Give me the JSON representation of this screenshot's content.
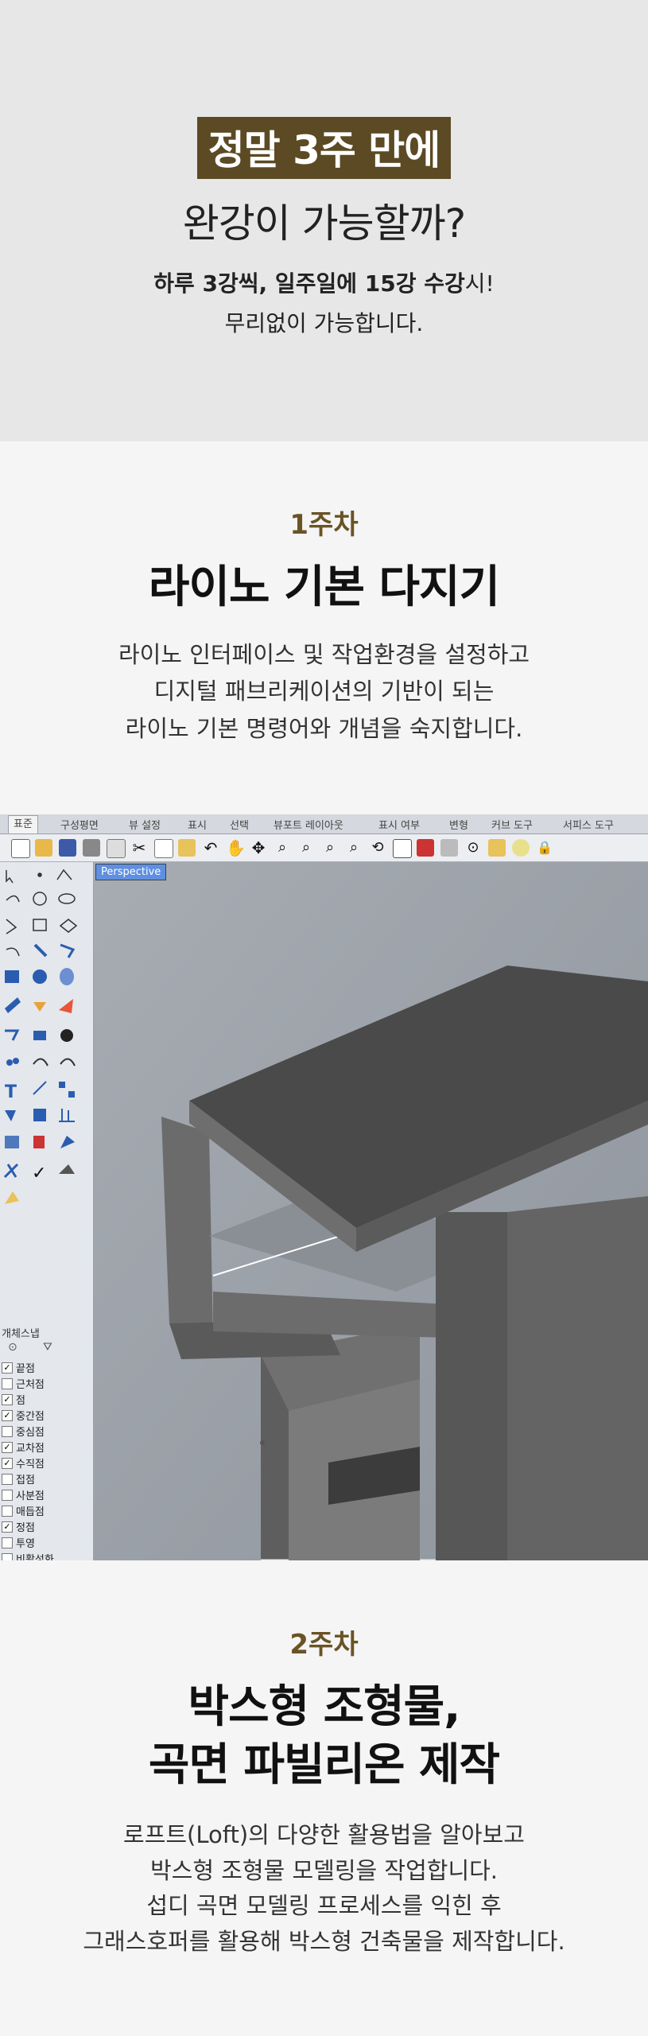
{
  "hero": {
    "title": "정말 3주 만에",
    "subtitle": "완강이 가능할까?",
    "line1_bold": "하루 3강씩, 일주일에 15강 수강",
    "line1_rest": "시!",
    "line2": "무리없이 가능합니다."
  },
  "week1": {
    "label": "1주차",
    "title": "라이노 기본 다지기",
    "desc": [
      "라이노 인터페이스 및 작업환경을 설정하고",
      "디지털 패브리케이션의 기반이 되는",
      "라이노 기본 명령어와 개념을 숙지합니다."
    ]
  },
  "rhino": {
    "tabs": [
      "표준",
      "구성평면",
      "뷰 설정",
      "표시",
      "선택",
      "뷰포트 레이아웃",
      "표시 여부",
      "변형",
      "커브 도구",
      "서피스 도구"
    ],
    "viewport_label": "Perspective",
    "osnap_title": "개체스냅",
    "osnaps": [
      {
        "label": "끝점",
        "checked": "✓"
      },
      {
        "label": "근처점",
        "checked": ""
      },
      {
        "label": "점",
        "checked": "✓"
      },
      {
        "label": "중간점",
        "checked": "✓"
      },
      {
        "label": "중심점",
        "checked": ""
      },
      {
        "label": "교차점",
        "checked": "✓"
      },
      {
        "label": "수직점",
        "checked": "✓"
      },
      {
        "label": "접점",
        "checked": ""
      },
      {
        "label": "사분점",
        "checked": ""
      },
      {
        "label": "매듭점",
        "checked": ""
      },
      {
        "label": "정점",
        "checked": "✓"
      },
      {
        "label": "투영",
        "checked": ""
      }
    ],
    "disable_label": "비활성화"
  },
  "week2": {
    "label": "2주차",
    "title_line1": "박스형 조형물,",
    "title_line2": "곡면 파빌리온 제작",
    "desc": [
      "로프트(Loft)의 다양한 활용법을 알아보고",
      "박스형 조형물 모델링을 작업합니다.",
      "섭디 곡면 모델링 프로세스를 익힌 후",
      "그래스호퍼를 활용해 박스형 건축물을 제작합니다."
    ]
  }
}
